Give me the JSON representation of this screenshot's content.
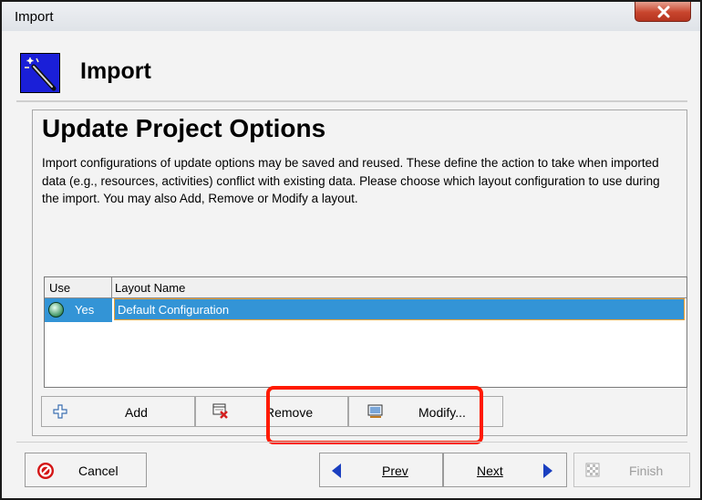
{
  "window": {
    "title": "Import"
  },
  "header": {
    "title": "Import"
  },
  "section": {
    "title": "Update Project Options",
    "description": "Import configurations of update options may be saved and reused.  These define the action to take when imported data (e.g., resources, activities) conflict with existing data.  Please choose which layout configuration to use during the import. You may also Add, Remove or Modify a layout."
  },
  "table": {
    "columns": [
      "Use",
      "Layout Name"
    ],
    "rows": [
      {
        "use": "Yes",
        "layout_name": "Default Configuration"
      }
    ]
  },
  "layout_buttons": {
    "add": "Add",
    "remove": "Remove",
    "modify": "Modify..."
  },
  "nav_buttons": {
    "cancel": "Cancel",
    "prev": "Prev",
    "next": "Next",
    "finish": "Finish"
  },
  "colors": {
    "selection": "#3394d6",
    "highlight_box": "#ff1a00",
    "header_icon_bg": "#1a1fd8"
  },
  "icons": [
    "close-icon",
    "magic-wand-icon",
    "globe-icon",
    "plus-icon",
    "remove-icon",
    "modify-icon",
    "cancel-icon",
    "prev-arrow-icon",
    "next-arrow-icon",
    "finish-icon"
  ]
}
